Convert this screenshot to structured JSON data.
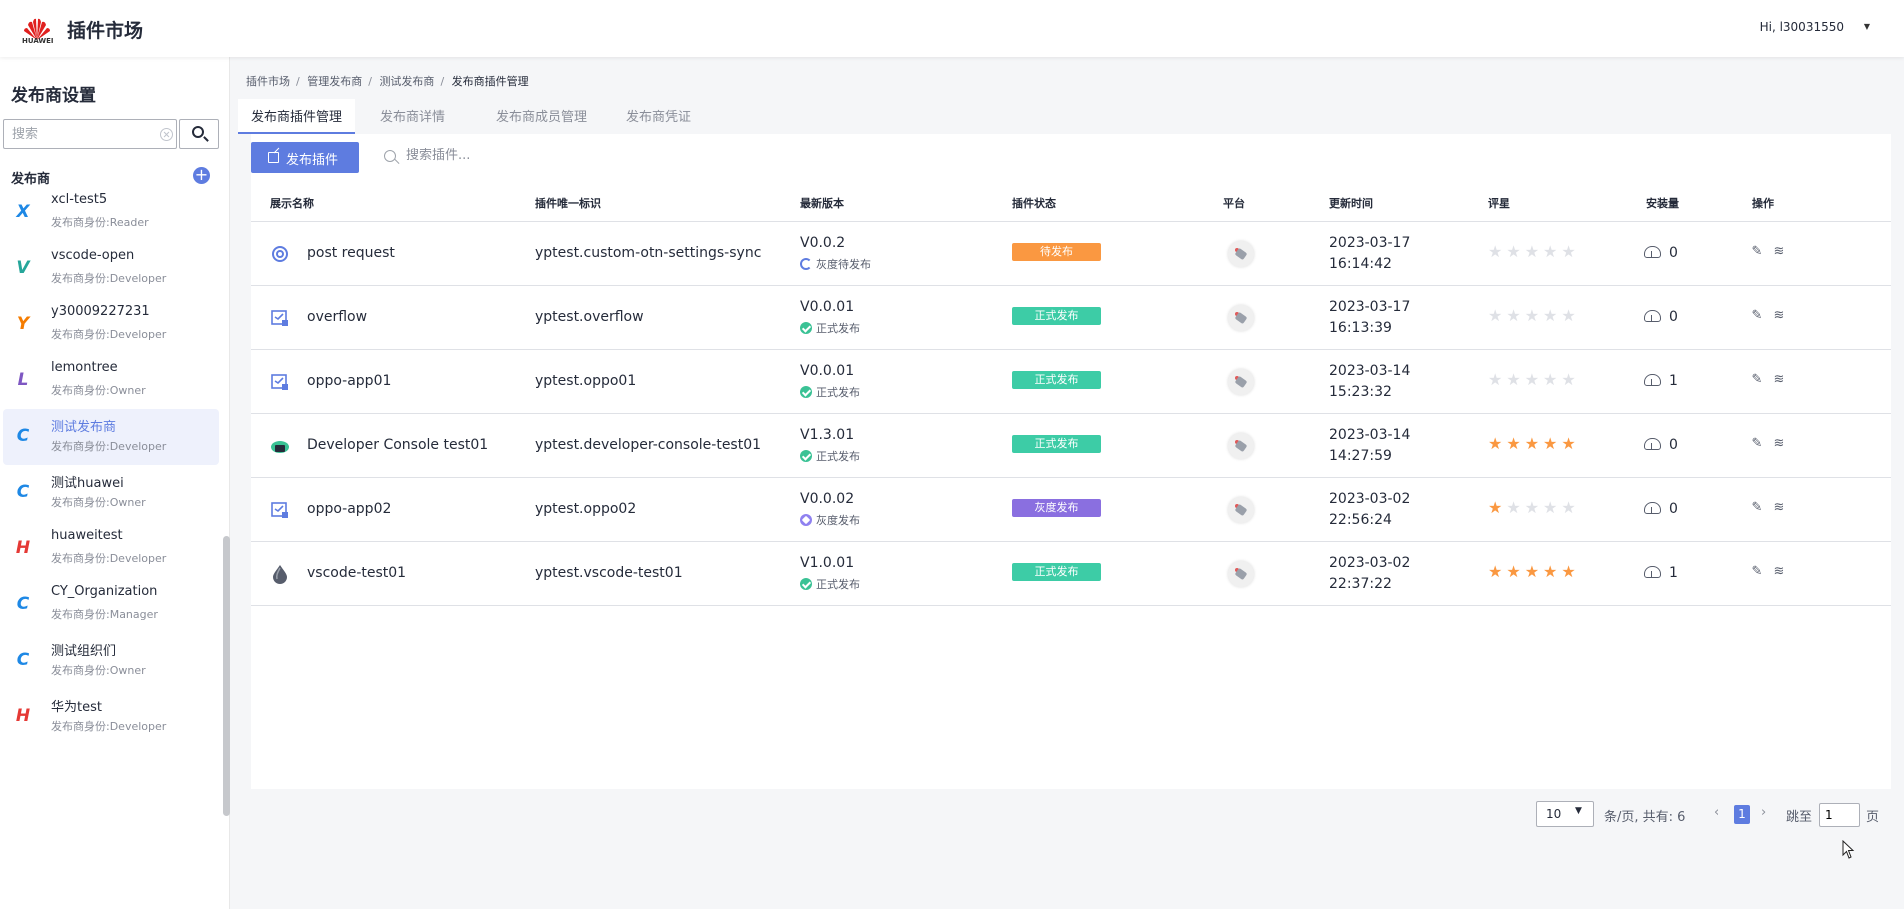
{
  "header": {
    "brand": "HUAWEI",
    "title": "插件市场",
    "user": "Hi, l30031550"
  },
  "sidebar": {
    "title": "发布商设置",
    "search_placeholder": "搜索",
    "section": "发布商",
    "items": [
      {
        "name": "xcl-test5",
        "role": "发布商身份:Reader",
        "icon": "X",
        "color": "#1e88e5",
        "active": false
      },
      {
        "name": "vscode-open",
        "role": "发布商身份:Developer",
        "icon": "V",
        "color": "#26a69a",
        "active": false
      },
      {
        "name": "y30009227231",
        "role": "发布商身份:Developer",
        "icon": "Y",
        "color": "#f57c00",
        "active": false
      },
      {
        "name": "lemontree",
        "role": "发布商身份:Owner",
        "icon": "L",
        "color": "#7e57c2",
        "active": false
      },
      {
        "name": "测试发布商",
        "role": "发布商身份:Developer",
        "icon": "C",
        "color": "#1e88e5",
        "active": true
      },
      {
        "name": "测试huawei",
        "role": "发布商身份:Owner",
        "icon": "C",
        "color": "#1e88e5",
        "active": false
      },
      {
        "name": "huaweitest",
        "role": "发布商身份:Developer",
        "icon": "H",
        "color": "#e53935",
        "active": false
      },
      {
        "name": "CY_Organization",
        "role": "发布商身份:Manager",
        "icon": "C",
        "color": "#1e88e5",
        "active": false
      },
      {
        "name": "测试组织们",
        "role": "发布商身份:Owner",
        "icon": "C",
        "color": "#1e88e5",
        "active": false
      },
      {
        "name": "华为test",
        "role": "发布商身份:Developer",
        "icon": "H",
        "color": "#e53935",
        "active": false
      }
    ]
  },
  "breadcrumb": [
    "插件市场",
    "管理发布商",
    "测试发布商",
    "发布商插件管理"
  ],
  "tabs": [
    "发布商插件管理",
    "发布商详情",
    "发布商成员管理",
    "发布商凭证"
  ],
  "toolbar": {
    "publish_label": "发布插件",
    "search_placeholder": "搜索插件..."
  },
  "table": {
    "columns": [
      "展示名称",
      "插件唯一标识",
      "最新版本",
      "插件状态",
      "平台",
      "更新时间",
      "评星",
      "安装量",
      "操作"
    ],
    "rows": [
      {
        "name": "post request",
        "id": "yptest.custom-otn-settings-sync",
        "version": "V0.0.2",
        "ver_status": "灰度待发布",
        "ver_icon": "gray",
        "status": "待发布",
        "status_color": "#fa9841",
        "date": "2023-03-17",
        "time": "16:14:42",
        "rating": 0,
        "installs": "0",
        "icon": "gear-icon"
      },
      {
        "name": "overflow",
        "id": "yptest.overflow",
        "version": "V0.0.01",
        "ver_status": "正式发布",
        "ver_icon": "ok",
        "status": "正式发布",
        "status_color": "#3dcca6",
        "date": "2023-03-17",
        "time": "16:13:39",
        "rating": 0,
        "installs": "0",
        "icon": "plugin-box-icon"
      },
      {
        "name": "oppo-app01",
        "id": "yptest.oppo01",
        "version": "V0.0.01",
        "ver_status": "正式发布",
        "ver_icon": "ok",
        "status": "正式发布",
        "status_color": "#3dcca6",
        "date": "2023-03-14",
        "time": "15:23:32",
        "rating": 0,
        "installs": "1",
        "icon": "plugin-box-icon"
      },
      {
        "name": "Developer Console test01",
        "id": "yptest.developer-console-test01",
        "version": "V1.3.01",
        "ver_status": "正式发布",
        "ver_icon": "ok",
        "status": "正式发布",
        "status_color": "#3dcca6",
        "date": "2023-03-14",
        "time": "14:27:59",
        "rating": 5,
        "installs": "0",
        "icon": "cloud-console-icon"
      },
      {
        "name": "oppo-app02",
        "id": "yptest.oppo02",
        "version": "V0.0.02",
        "ver_status": "灰度发布",
        "ver_icon": "purple",
        "status": "灰度发布",
        "status_color": "#8a6fe0",
        "date": "2023-03-02",
        "time": "22:56:24",
        "rating": 1,
        "installs": "0",
        "icon": "plugin-box-icon"
      },
      {
        "name": "vscode-test01",
        "id": "yptest.vscode-test01",
        "version": "V1.0.01",
        "ver_status": "正式发布",
        "ver_icon": "ok",
        "status": "正式发布",
        "status_color": "#3dcca6",
        "date": "2023-03-02",
        "time": "22:37:22",
        "rating": 5,
        "installs": "1",
        "icon": "drop-icon"
      }
    ]
  },
  "pagination": {
    "page_size": "10",
    "summary": "条/页, 共有: 6",
    "current": "1",
    "jump_label": "跳至",
    "jump_value": "1",
    "page_label": "页"
  },
  "colors": {
    "primary": "#5e7ce0",
    "star_on": "#fa9841",
    "star_off": "#dfe1e6"
  }
}
